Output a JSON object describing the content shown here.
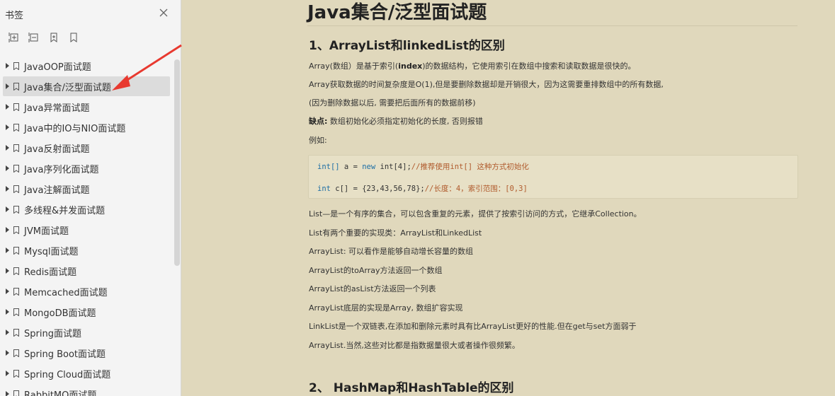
{
  "sidebar": {
    "title": "书签",
    "toolbar": [
      "expand-all-icon",
      "collapse-all-icon",
      "add-bookmark-icon",
      "bookmark-icon"
    ],
    "items": [
      {
        "label": "JavaOOP面试题",
        "active": false
      },
      {
        "label": "Java集合/泛型面试题",
        "active": true
      },
      {
        "label": "Java异常面试题",
        "active": false
      },
      {
        "label": "Java中的IO与NIO面试题",
        "active": false
      },
      {
        "label": "Java反射面试题",
        "active": false
      },
      {
        "label": "Java序列化面试题",
        "active": false
      },
      {
        "label": "Java注解面试题",
        "active": false
      },
      {
        "label": "多线程&并发面试题",
        "active": false
      },
      {
        "label": "JVM面试题",
        "active": false
      },
      {
        "label": "Mysql面试题",
        "active": false
      },
      {
        "label": "Redis面试题",
        "active": false
      },
      {
        "label": "Memcached面试题",
        "active": false
      },
      {
        "label": "MongoDB面试题",
        "active": false
      },
      {
        "label": "Spring面试题",
        "active": false
      },
      {
        "label": "Spring Boot面试题",
        "active": false
      },
      {
        "label": "Spring Cloud面试题",
        "active": false
      },
      {
        "label": "RabbitMQ面试题",
        "active": false
      }
    ]
  },
  "document": {
    "title": "Java集合/泛型面试题",
    "section1": {
      "heading": "1、ArrayList和linkedList的区别",
      "p1_a": "Array(数组）是基于索引(",
      "p1_b": "index",
      "p1_c": ")的数据结构，它使用索引在数组中搜索和读取数据是很快的。",
      "p2": "Array获取数据的时间复杂度是O(1),但是要删除数据却是开销很大，因为这需要重排数组中的所有数据,",
      "p3": "(因为删除数据以后, 需要把后面所有的数据前移)",
      "p4_label": "缺点:",
      "p4_text": " 数组初始化必须指定初始化的长度, 否则报错",
      "p5": "例如:",
      "code": [
        {
          "type": "int[]",
          "var": " a = ",
          "kw": "new",
          "rest": " int[4];",
          "comment": "//推荐使用int[] 这种方式初始化"
        },
        {
          "type": "int",
          "var": " c[] = {23,43,56,78};",
          "kw": "",
          "rest": "",
          "comment": "//长度：4，索引范围：[0,3]"
        }
      ],
      "lines": [
        "List—是一个有序的集合，可以包含重复的元素，提供了按索引访问的方式，它继承Collection。",
        "List有两个重要的实现类：ArrayList和LinkedList",
        "ArrayList: 可以看作是能够自动增长容量的数组",
        "ArrayList的toArray方法返回一个数组",
        "ArrayList的asList方法返回一个列表",
        "ArrayList底层的实现是Array, 数组扩容实现",
        "LinkList是一个双链表,在添加和删除元素时具有比ArrayList更好的性能.但在get与set方面弱于",
        "ArrayList.当然,这些对比都是指数据量很大或者操作很频繁。"
      ]
    },
    "section2": {
      "heading": "2、 HashMap和HashTable的区别"
    }
  },
  "colors": {
    "page_bg": "#e0d8bc",
    "sidebar_bg": "#f4f4f4",
    "active_item": "#dcdcdc",
    "arrow": "#e8392f"
  }
}
